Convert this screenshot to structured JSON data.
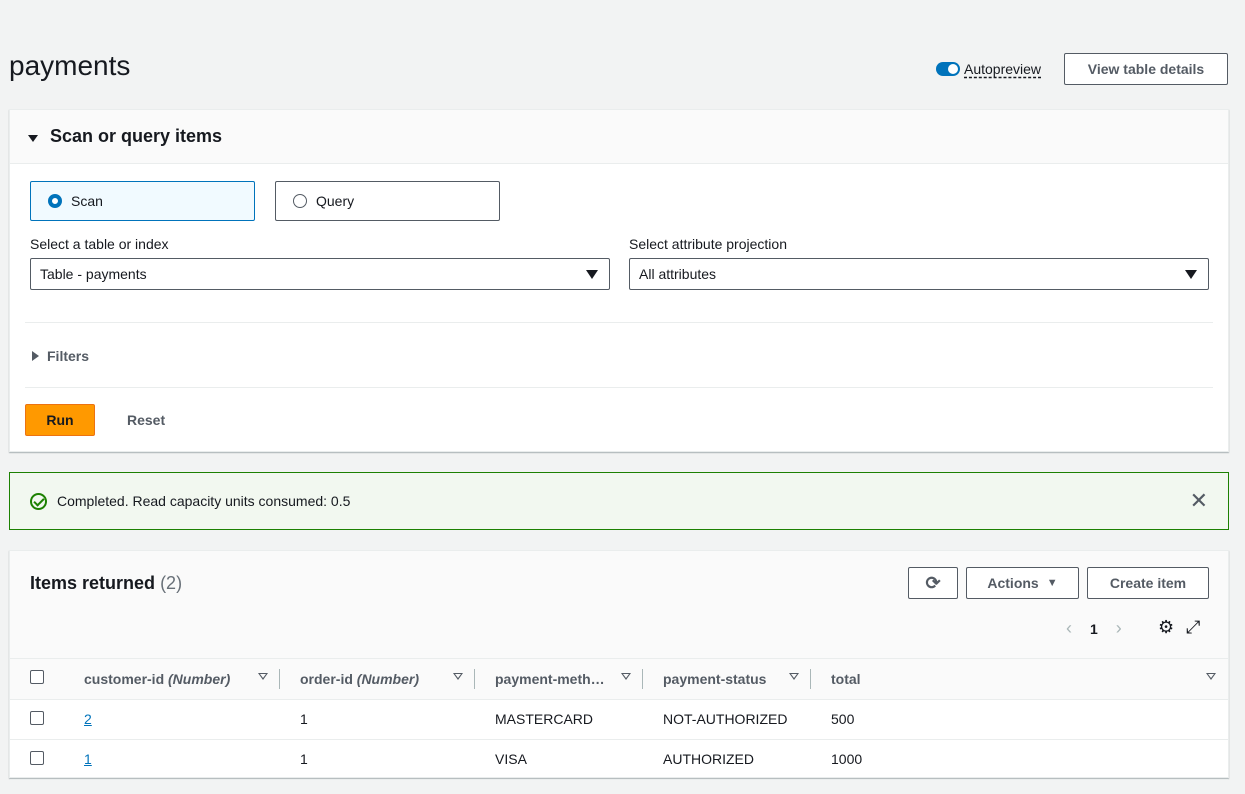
{
  "page": {
    "title": "payments",
    "autopreview_label": "Autopreview",
    "view_details_label": "View table details"
  },
  "scan_panel": {
    "title": "Scan or query items",
    "scan_label": "Scan",
    "query_label": "Query",
    "table_label": "Select a table or index",
    "table_value": "Table - payments",
    "projection_label": "Select attribute projection",
    "projection_value": "All attributes",
    "filters_label": "Filters",
    "run_label": "Run",
    "reset_label": "Reset"
  },
  "flash": {
    "message": "Completed. Read capacity units consumed: 0.5"
  },
  "items": {
    "title": "Items returned",
    "count": "(2)",
    "actions_label": "Actions",
    "create_label": "Create item",
    "page_number": "1",
    "columns": [
      {
        "name": "customer-id",
        "type": "(Number)"
      },
      {
        "name": "order-id",
        "type": "(Number)"
      },
      {
        "name": "payment-meth…",
        "type": ""
      },
      {
        "name": "payment-status",
        "type": ""
      },
      {
        "name": "total",
        "type": ""
      }
    ],
    "rows": [
      {
        "customer_id": "2",
        "order_id": "1",
        "payment_method": "MASTERCARD",
        "payment_status": "NOT-AUTHORIZED",
        "total": "500"
      },
      {
        "customer_id": "1",
        "order_id": "1",
        "payment_method": "VISA",
        "payment_status": "AUTHORIZED",
        "total": "1000"
      }
    ]
  },
  "colors": {
    "accent": "#0073bb",
    "run_button": "#ff9900",
    "success": "#1d8102"
  }
}
